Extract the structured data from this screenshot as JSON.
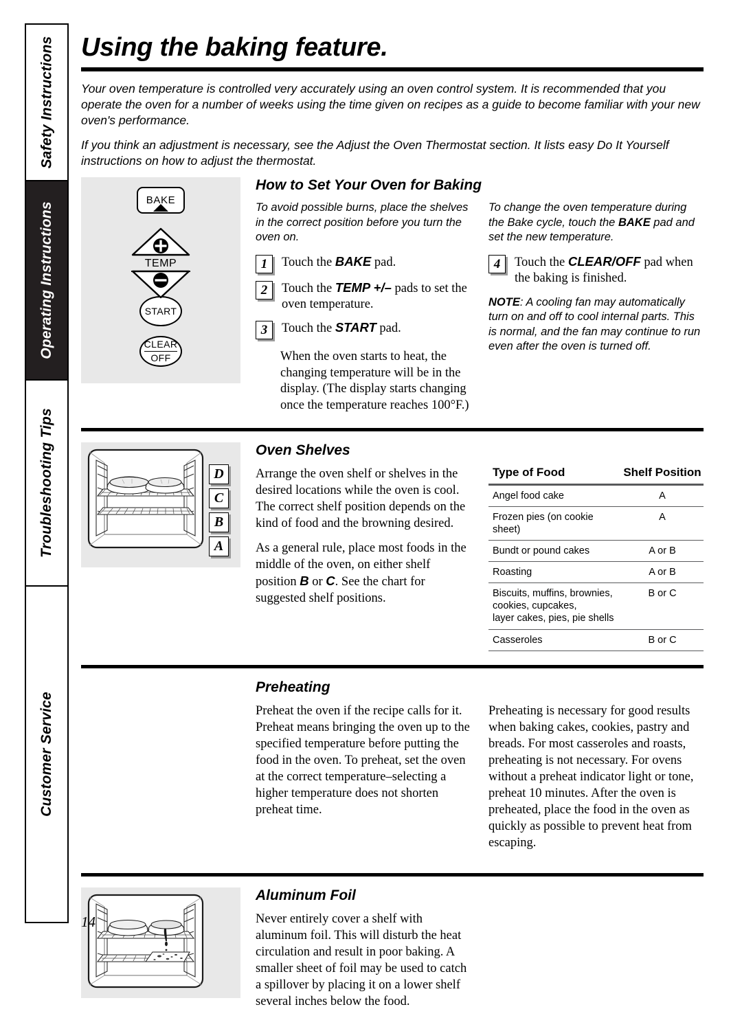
{
  "sidebar": {
    "tabs": [
      {
        "label": "Safety Instructions",
        "state": "inactive"
      },
      {
        "label": "Operating Instructions",
        "state": "active"
      },
      {
        "label": "Troubleshooting Tips",
        "state": "inactive"
      },
      {
        "label": "Customer Service",
        "state": "inactive"
      }
    ]
  },
  "page": {
    "title": "Using the baking feature.",
    "number": "14",
    "intro": [
      "Your oven temperature is controlled very accurately using an oven control system. It is recommended that you operate the oven for a number of weeks using the time given on recipes as a guide to become familiar with your new oven's performance.",
      "If you think an adjustment is necessary, see the Adjust the Oven Thermostat section. It lists easy Do It Yourself instructions on how to adjust the thermostat."
    ]
  },
  "baking": {
    "heading": "How to Set Your Oven for Baking",
    "lead": "To avoid possible burns, place the shelves in the correct position before you turn the oven on.",
    "steps": [
      {
        "num": "1",
        "pre": "Touch the ",
        "pad": "BAKE",
        "post": " pad."
      },
      {
        "num": "2",
        "pre": "Touch the ",
        "pad": "TEMP +/–",
        "post": " pads to set the oven temperature."
      },
      {
        "num": "3",
        "pre": "Touch the ",
        "pad": "START",
        "post": " pad."
      },
      {
        "num": "4",
        "pre": "Touch the ",
        "pad": "CLEAR/OFF",
        "post": " pad when the baking is finished."
      }
    ],
    "step3_continuation": "When the oven starts to heat, the changing temperature will be in the display. (The display starts changing once the temperature reaches 100°F.)",
    "change_temp": {
      "before": "To change the oven temperature during the Bake cycle, touch the ",
      "pad": "BAKE",
      "after": " pad and set the new temperature."
    },
    "note": {
      "label": "NOTE",
      "text": ": A cooling fan may automatically turn on and off to cool internal parts. This is normal, and the fan may continue to run even after the oven is turned off."
    },
    "control_panel": {
      "bake_pad": "BAKE",
      "temp_label": "TEMP",
      "temp_plus": "+",
      "temp_minus": "–",
      "start_pad": "START",
      "clear_pad_line1": "CLEAR",
      "clear_pad_line2": "OFF"
    }
  },
  "shelves": {
    "heading": "Oven Shelves",
    "paragraphs": [
      "Arrange the oven shelf or shelves in the desired locations while the oven is cool. The correct shelf position depends on the kind of food and the browning desired."
    ],
    "rule": {
      "pre": "As a general rule, place most foods in the middle of the oven, on either shelf position ",
      "b": "B",
      "mid": " or ",
      "c": "C",
      "post": ". See the chart for suggested shelf positions."
    },
    "shelf_letters": [
      "D",
      "C",
      "B",
      "A"
    ],
    "table": {
      "columns": [
        "Type of Food",
        "Shelf Position"
      ],
      "rows": [
        {
          "food": "Angel food cake",
          "position": "A"
        },
        {
          "food": "Frozen pies (on cookie sheet)",
          "position": "A"
        },
        {
          "food": "Bundt or pound cakes",
          "position": "A or B"
        },
        {
          "food": "Roasting",
          "position": "A or B"
        },
        {
          "food": "Biscuits, muffins, brownies,\ncookies, cupcakes,\nlayer cakes, pies, pie shells",
          "position": "B or C"
        },
        {
          "food": "Casseroles",
          "position": "B or C"
        }
      ]
    }
  },
  "preheating": {
    "heading": "Preheating",
    "col_left": "Preheat the oven if the recipe calls for it. Preheat means bringing the oven up to the specified temperature before putting the food in the oven. To preheat, set the oven at the correct temperature–selecting a higher temperature does not shorten preheat time.",
    "col_right": "Preheating is necessary for good results when baking cakes, cookies, pastry and breads. For most casseroles and roasts, preheating is not necessary. For ovens without a preheat indicator light or tone, preheat 10 minutes. After the oven is preheated, place the food in the oven as quickly as possible to prevent heat from escaping."
  },
  "foil": {
    "heading": "Aluminum Foil",
    "text": "Never entirely cover a shelf with aluminum foil. This will disturb the heat circulation and result in poor baking. A smaller sheet of foil may be used to catch a spillover by placing it on a lower shelf several inches below the food."
  },
  "colors": {
    "panel_background": "#e8e8e8",
    "active_tab_background": "#231f20",
    "rule": "#000000",
    "table_rule": "#58595b"
  }
}
